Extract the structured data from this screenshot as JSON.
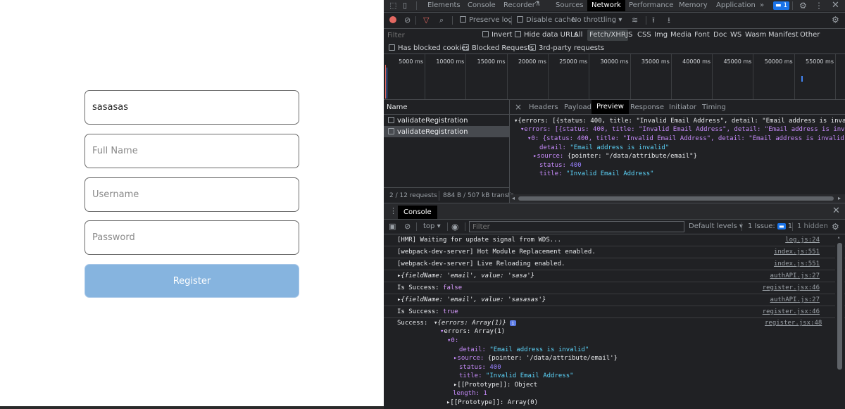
{
  "form": {
    "email_value": "sasasas",
    "fullname_placeholder": "Full Name",
    "username_placeholder": "Username",
    "password_placeholder": "Password",
    "register_label": "Register"
  },
  "devtools": {
    "tabs": [
      "Elements",
      "Console",
      "Recorder",
      "Sources",
      "Network",
      "Performance",
      "Memory",
      "Application"
    ],
    "tabs_more": "»",
    "issues_count": "1",
    "toolbar": {
      "preserve_log": "Preserve log",
      "disable_cache": "Disable cache",
      "throttling": "No throttling"
    },
    "filter_bar": {
      "filter_placeholder": "Filter",
      "invert": "Invert",
      "hide_data_urls": "Hide data URLs",
      "types": [
        "All",
        "Fetch/XHR",
        "JS",
        "CSS",
        "Img",
        "Media",
        "Font",
        "Doc",
        "WS",
        "Wasm",
        "Manifest",
        "Other"
      ]
    },
    "row3": {
      "blocked_cookies": "Has blocked cookies",
      "blocked_requests": "Blocked Requests",
      "third_party": "3rd-party requests"
    },
    "timeline_ticks": [
      "5000 ms",
      "10000 ms",
      "15000 ms",
      "20000 ms",
      "25000 ms",
      "30000 ms",
      "35000 ms",
      "40000 ms",
      "45000 ms",
      "50000 ms",
      "55000 ms"
    ],
    "requests": {
      "name_header": "Name",
      "items": [
        "validateRegistration",
        "validateRegistration"
      ],
      "summary": "2 / 12 requests",
      "transfer": "884 B / 507 kB transfe"
    },
    "detail_tabs": [
      "Headers",
      "Payload",
      "Preview",
      "Response",
      "Initiator",
      "Timing"
    ],
    "close_x": "×",
    "preview": {
      "line1": "{errors: [{status: 400, title: \"Invalid Email Address\", detail: \"Email address is invalid\",",
      "line2": "errors: [{status: 400, title: \"Invalid Email Address\", detail: \"Email address is invalid\",",
      "line3": "0: {status: 400, title: \"Invalid Email Address\", detail: \"Email address is invalid\",…}",
      "detail_key": "detail:",
      "detail_val": "\"Email address is invalid\"",
      "source_key": "source:",
      "source_val": "{pointer: \"/data/attribute/email\"}",
      "status_key": "status:",
      "status_val": "400",
      "title_key": "title:",
      "title_val": "\"Invalid Email Address\""
    },
    "console": {
      "tab_label": "Console",
      "context": "top",
      "filter_placeholder": "Filter",
      "levels": "Default levels",
      "issue_label": "1 Issue:",
      "issue_count": "1",
      "hidden": "1 hidden",
      "rows": [
        {
          "msg": "[HMR] Waiting for update signal from WDS...",
          "src": "log.js:24"
        },
        {
          "msg": "[webpack-dev-server] Hot Module Replacement enabled.",
          "src": "index.js:551"
        },
        {
          "msg": "[webpack-dev-server] Live Reloading enabled.",
          "src": "index.js:551"
        },
        {
          "msg": "{fieldName: 'email', value: 'sasa'}",
          "src": "authAPI.js:27"
        },
        {
          "msg": "Is Success:",
          "val": "false",
          "src": "register.jsx:46"
        },
        {
          "msg": "{fieldName: 'email', value: 'sasasas'}",
          "src": "authAPI.js:27"
        },
        {
          "msg": "Is Success:",
          "val": "true",
          "src": "register.jsx:46"
        }
      ],
      "success": {
        "label": "Success:",
        "src": "register.jsx:48",
        "head": "{errors: Array(1)}",
        "errors": "errors: Array(1)",
        "zero": "0:",
        "detail_key": "detail:",
        "detail_val": "\"Email address is invalid\"",
        "source_key": "source:",
        "source_val": "{pointer: '/data/attribute/email'}",
        "status_key": "status:",
        "status_val": "400",
        "title_key": "title:",
        "title_val": "\"Invalid Email Address\"",
        "proto_obj": "[[Prototype]]: Object",
        "length": "length: 1",
        "proto_arr": "[[Prototype]]: Array(0)"
      }
    }
  }
}
